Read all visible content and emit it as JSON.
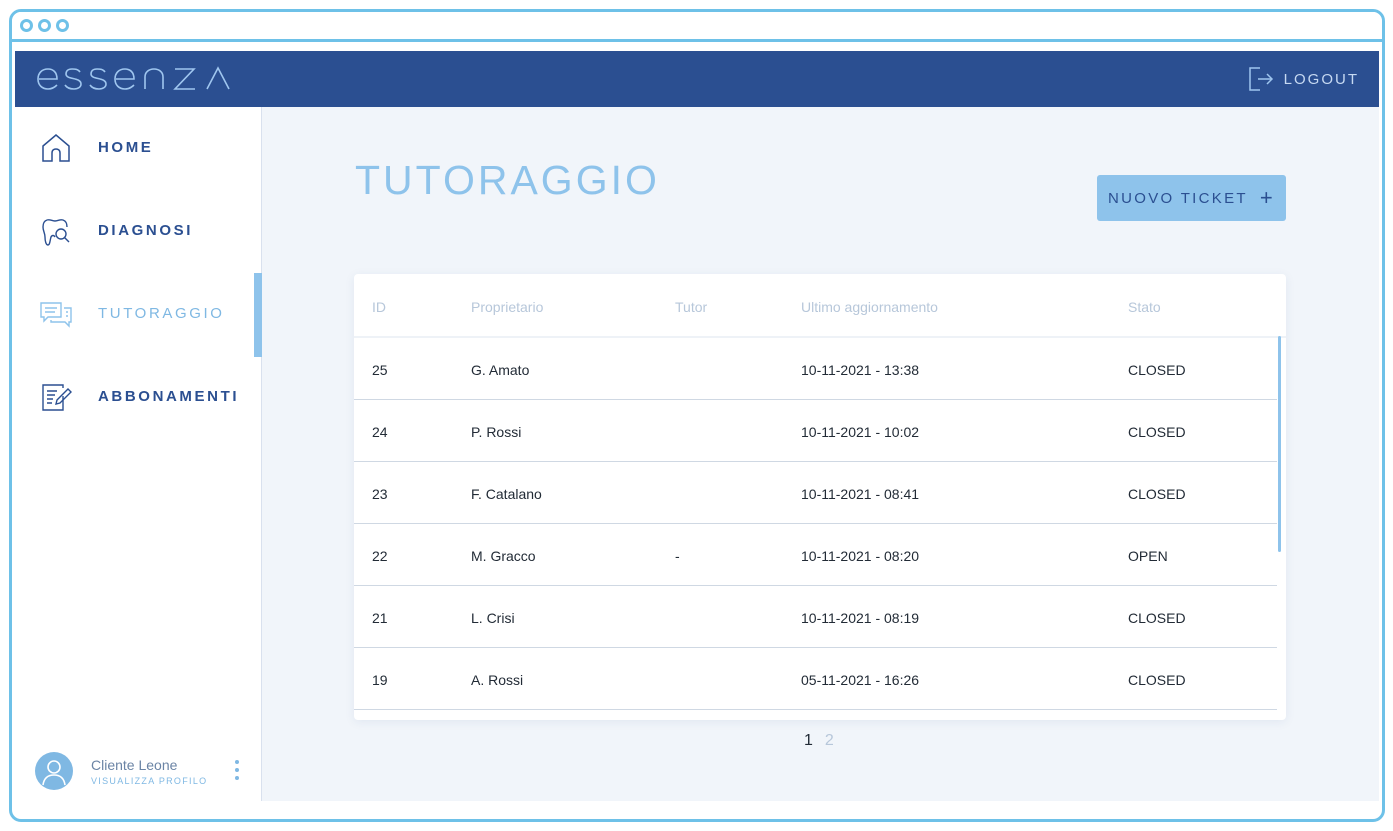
{
  "header": {
    "brand": "essenza",
    "logout_label": "LOGOUT",
    "logout_icon": "logout-icon",
    "colors": {
      "header_bg": "#2b4f91",
      "accent": "#8ec3eb"
    }
  },
  "sidebar": {
    "items": [
      {
        "label": "HOME",
        "icon": "home-icon",
        "active": false
      },
      {
        "label": "DIAGNOSI",
        "icon": "tooth-search-icon",
        "active": false
      },
      {
        "label": "TUTORAGGIO",
        "icon": "chat-icon",
        "active": true
      },
      {
        "label": "ABBONAMENTI",
        "icon": "document-edit-icon",
        "active": false
      }
    ],
    "profile": {
      "name": "Cliente Leone",
      "link": "VISUALIZZA PROFILO"
    }
  },
  "main": {
    "title": "TUTORAGGIO",
    "new_ticket_label": "NUOVO TICKET",
    "new_ticket_icon": "+",
    "table": {
      "columns": [
        "ID",
        "Proprietario",
        "Tutor",
        "Ultimo aggiornamento",
        "Stato"
      ],
      "rows": [
        {
          "id": "25",
          "owner": "G. Amato",
          "tutor": "",
          "updated": "10-11-2021 - 13:38",
          "state": "CLOSED"
        },
        {
          "id": "24",
          "owner": "P. Rossi",
          "tutor": "",
          "updated": "10-11-2021 - 10:02",
          "state": "CLOSED"
        },
        {
          "id": "23",
          "owner": "F. Catalano",
          "tutor": "",
          "updated": "10-11-2021 - 08:41",
          "state": "CLOSED"
        },
        {
          "id": "22",
          "owner": "M. Gracco",
          "tutor": "-",
          "updated": "10-11-2021 - 08:20",
          "state": "OPEN"
        },
        {
          "id": "21",
          "owner": "L. Crisi",
          "tutor": "",
          "updated": "10-11-2021 - 08:19",
          "state": "CLOSED"
        },
        {
          "id": "19",
          "owner": "A. Rossi",
          "tutor": "",
          "updated": "05-11-2021 - 16:26",
          "state": "CLOSED"
        }
      ]
    },
    "pagination": {
      "pages": [
        "1",
        "2"
      ],
      "current": "1"
    }
  }
}
